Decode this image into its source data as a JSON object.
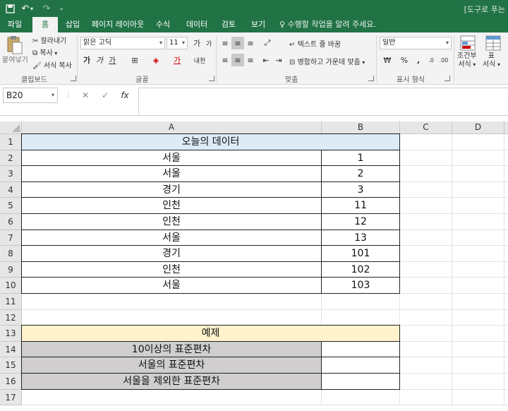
{
  "titlebar": {
    "doc_title": "[도구로 푸는"
  },
  "tabs": [
    "파일",
    "홈",
    "삽입",
    "페이지 레이아웃",
    "수식",
    "데이터",
    "검토",
    "보기"
  ],
  "tell_me": "수행할 작업을 알려 주세요.",
  "ribbon": {
    "paste_label": "붙여넣기",
    "cut_label": "잘라내기",
    "copy_label": "복사",
    "format_painter_label": "서식 복사",
    "clipboard_group": "클립보드",
    "font_name": "맑은 고딕",
    "font_size": "11",
    "font_group": "글꼴",
    "wrap_text_label": "텍스트 줄 바꿈",
    "merge_center_label": "병합하고 가운데 맞춤",
    "alignment_group": "맞춤",
    "number_format": "일반",
    "number_group": "표시 형식",
    "conditional_label": "조건부\n서식",
    "conditional_line1": "조건부",
    "conditional_line2": "서식",
    "table_line1": "표",
    "table_line2": "서식"
  },
  "formula_bar": {
    "name_box": "B20",
    "formula": ""
  },
  "columns": [
    "A",
    "B",
    "C",
    "D"
  ],
  "rows": [
    "1",
    "2",
    "3",
    "4",
    "5",
    "6",
    "7",
    "8",
    "9",
    "10",
    "11",
    "12",
    "13",
    "14",
    "15",
    "16",
    "17"
  ],
  "sheet": {
    "header_title": "오늘의 데이터",
    "data": [
      {
        "city": "서울",
        "value": "1"
      },
      {
        "city": "서울",
        "value": "2"
      },
      {
        "city": "경기",
        "value": "3"
      },
      {
        "city": "인천",
        "value": "11"
      },
      {
        "city": "인천",
        "value": "12"
      },
      {
        "city": "서울",
        "value": "13"
      },
      {
        "city": "경기",
        "value": "101"
      },
      {
        "city": "인천",
        "value": "102"
      },
      {
        "city": "서울",
        "value": "103"
      }
    ],
    "example_title": "예제",
    "examples": [
      {
        "label": "10이상의 표준편차",
        "value": ""
      },
      {
        "label": "서울의 표준편차",
        "value": ""
      },
      {
        "label": "서울을 제외한 표준편차",
        "value": ""
      }
    ]
  },
  "colors": {
    "excel_green": "#217346",
    "header_blue": "#ddebf7",
    "example_yellow": "#fff2cc",
    "label_gray": "#d0cece"
  }
}
